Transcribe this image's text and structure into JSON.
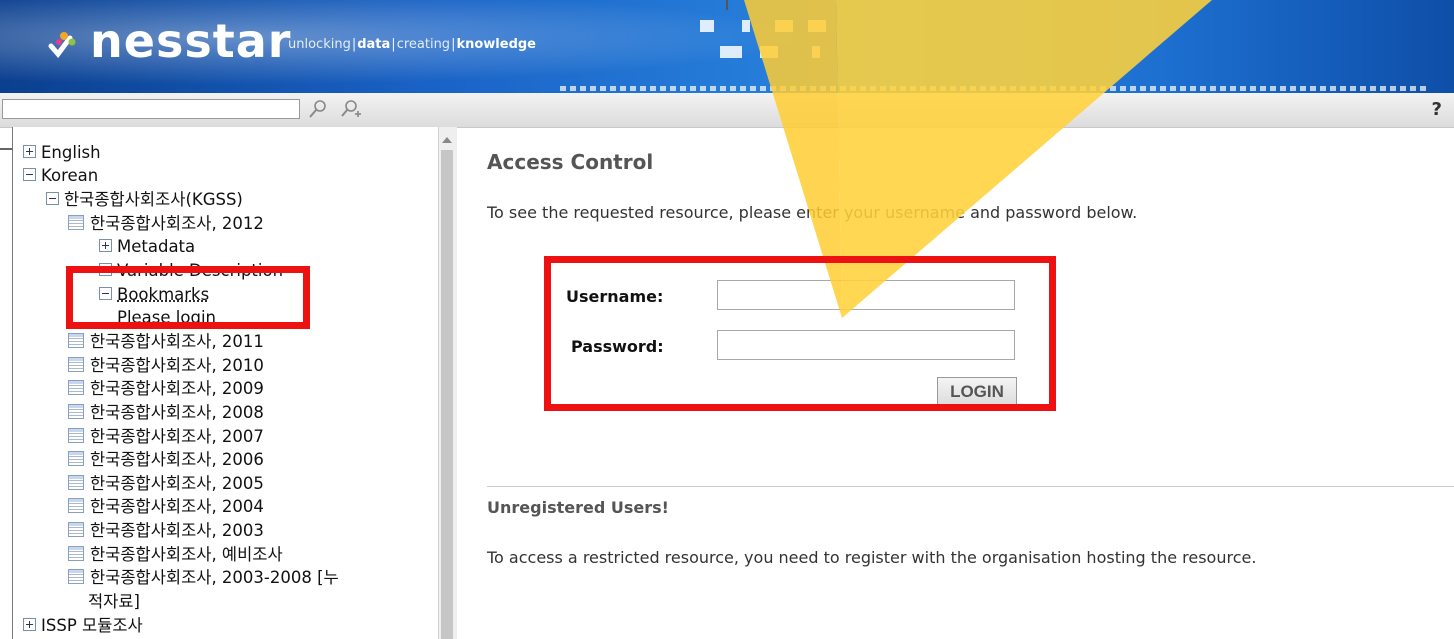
{
  "banner": {
    "brand": "nesstar",
    "tagline": [
      "unlocking",
      "data",
      "creating",
      "knowledge"
    ]
  },
  "toolbar": {
    "search_value": "",
    "icons": [
      "search-icon",
      "advanced-search-icon",
      "help-icon"
    ],
    "help_label": "?"
  },
  "tree": {
    "nodes": [
      {
        "label": "English",
        "toggle": "plus"
      },
      {
        "label": "Korean",
        "toggle": "minus"
      },
      {
        "label": "한국종합사회조사(KGSS)",
        "toggle": "minus"
      },
      {
        "label": "한국종합사회조사, 2012",
        "icon": "table"
      },
      {
        "label": "Metadata",
        "toggle": "plus"
      },
      {
        "label": "Variable Description",
        "toggle": "minus"
      },
      {
        "label": "Bookmarks",
        "toggle": "minus"
      },
      {
        "label": "Please login"
      },
      {
        "label": "한국종합사회조사, 2011",
        "icon": "table"
      },
      {
        "label": "한국종합사회조사, 2010",
        "icon": "table"
      },
      {
        "label": "한국종합사회조사, 2009",
        "icon": "table"
      },
      {
        "label": "한국종합사회조사, 2008",
        "icon": "table"
      },
      {
        "label": "한국종합사회조사, 2007",
        "icon": "table"
      },
      {
        "label": "한국종합사회조사, 2006",
        "icon": "table"
      },
      {
        "label": "한국종합사회조사, 2005",
        "icon": "table"
      },
      {
        "label": "한국종합사회조사, 2004",
        "icon": "table"
      },
      {
        "label": "한국종합사회조사, 2003",
        "icon": "table"
      },
      {
        "label": "한국종합사회조사, 예비조사",
        "icon": "table"
      },
      {
        "label": "한국종합사회조사, 2003-2008 [누",
        "icon": "table"
      },
      {
        "label": "적자료]"
      },
      {
        "label": "ISSP 모듈조사",
        "toggle": "plus"
      }
    ]
  },
  "main": {
    "title": "Access Control",
    "intro": "To see the requested resource, please enter your username and password below.",
    "username_label": "Username:",
    "password_label": "Password:",
    "username_value": "",
    "password_value": "",
    "login_label": "LOGIN",
    "unregistered_title": "Unregistered Users!",
    "restricted_text": "To access a restricted resource, you need to register with the organisation hosting the resource."
  },
  "annotation": {
    "box_color": "#ee1111",
    "arrow_color": "#ffcc33"
  }
}
